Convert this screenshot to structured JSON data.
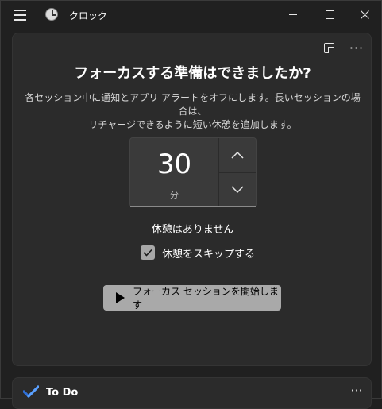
{
  "window": {
    "title": "クロック",
    "icons": {
      "menu": "hamburger-menu-icon",
      "app": "clock-app-icon",
      "minimize": "minimize-icon",
      "maximize": "maximize-icon",
      "close": "close-icon"
    }
  },
  "focus": {
    "heading": "フォーカスする準備はできましたか?",
    "description_line1": "各セッション中に通知とアプリ アラートをオフにします。長いセッションの場合は、",
    "description_line2": "リチャージできるように短い休憩を追加します。",
    "timer_value": "30",
    "timer_unit": "分",
    "breaks_text": "休憩はありません",
    "skip_breaks_label": "休憩をスキップする",
    "skip_breaks_checked": true,
    "start_button_label": "フォーカス セッションを開始します",
    "more_label": "···"
  },
  "todo": {
    "title": "To Do",
    "more_label": "···"
  },
  "colors": {
    "background": "#202020",
    "card": "#2b2b2b",
    "timer_box": "#3a3a3a",
    "start_button": "#a9a9a9",
    "todo_accent": "#4a8df0"
  }
}
